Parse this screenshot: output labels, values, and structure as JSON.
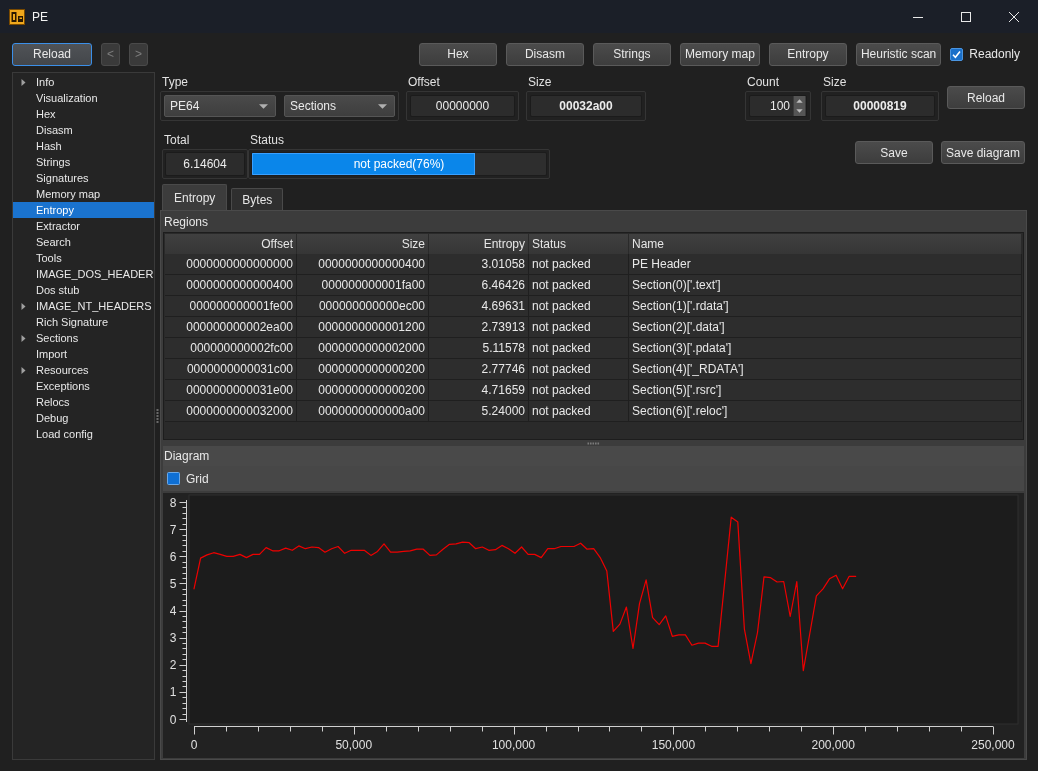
{
  "window": {
    "title": "PE"
  },
  "toolbar": {
    "reload": {
      "label": "Reload",
      "focused": true
    },
    "nav": [
      {
        "label": "<",
        "disabled": true
      },
      {
        "label": ">",
        "disabled": true
      }
    ],
    "views": [
      "Hex",
      "Disasm",
      "Strings",
      "Memory map",
      "Entropy",
      "Heuristic scan"
    ],
    "readonly": {
      "label": "Readonly",
      "checked": true
    }
  },
  "sidebar": {
    "items": [
      {
        "label": "Info",
        "kind": "group",
        "expanded": false,
        "selected": false
      },
      {
        "label": "Visualization",
        "kind": "item",
        "selected": false
      },
      {
        "label": "Hex",
        "kind": "item",
        "selected": false
      },
      {
        "label": "Disasm",
        "kind": "item",
        "selected": false
      },
      {
        "label": "Hash",
        "kind": "item",
        "selected": false
      },
      {
        "label": "Strings",
        "kind": "item",
        "selected": false
      },
      {
        "label": "Signatures",
        "kind": "item",
        "selected": false
      },
      {
        "label": "Memory map",
        "kind": "item",
        "selected": false
      },
      {
        "label": "Entropy",
        "kind": "item",
        "selected": true
      },
      {
        "label": "Extractor",
        "kind": "item",
        "selected": false
      },
      {
        "label": "Search",
        "kind": "item",
        "selected": false
      },
      {
        "label": "Tools",
        "kind": "item",
        "selected": false
      },
      {
        "label": "IMAGE_DOS_HEADER",
        "kind": "item",
        "selected": false
      },
      {
        "label": "Dos stub",
        "kind": "item",
        "selected": false
      },
      {
        "label": "IMAGE_NT_HEADERS",
        "kind": "group",
        "expanded": false,
        "selected": false
      },
      {
        "label": "Rich Signature",
        "kind": "item",
        "selected": false
      },
      {
        "label": "Sections",
        "kind": "group",
        "expanded": false,
        "selected": false
      },
      {
        "label": "Import",
        "kind": "item",
        "selected": false
      },
      {
        "label": "Resources",
        "kind": "group",
        "expanded": false,
        "selected": false
      },
      {
        "label": "Exceptions",
        "kind": "item",
        "selected": false
      },
      {
        "label": "Relocs",
        "kind": "item",
        "selected": false
      },
      {
        "label": "Debug",
        "kind": "item",
        "selected": false
      },
      {
        "label": "Load config",
        "kind": "item",
        "selected": false
      }
    ]
  },
  "entropy": {
    "type": {
      "label": "Type",
      "format": "PE64",
      "mode": "Sections"
    },
    "offset": {
      "label": "Offset",
      "value": "00000000"
    },
    "size": {
      "label": "Size",
      "value": "00032a00"
    },
    "count": {
      "label": "Count",
      "value": "100"
    },
    "block_size": {
      "label": "Size",
      "value": "00000819"
    },
    "reload": "Reload",
    "total": {
      "label": "Total",
      "value": "6.14604"
    },
    "status": {
      "label": "Status",
      "text": "not packed(76%)",
      "level": 0.76
    },
    "save": "Save",
    "save_diagram": "Save diagram"
  },
  "tabs": [
    {
      "label": "Entropy",
      "selected": true
    },
    {
      "label": "Bytes",
      "selected": false
    }
  ],
  "regions": {
    "title": "Regions",
    "columns": [
      "Offset",
      "Size",
      "Entropy",
      "Status",
      "Name"
    ],
    "rows": [
      [
        "0000000000000000",
        "0000000000000400",
        "3.01058",
        "not packed",
        "PE Header"
      ],
      [
        "0000000000000400",
        "000000000001fa00",
        "6.46426",
        "not packed",
        "Section(0)['.text']"
      ],
      [
        "000000000001fe00",
        "000000000000ec00",
        "4.69631",
        "not packed",
        "Section(1)['.rdata']"
      ],
      [
        "000000000002ea00",
        "0000000000001200",
        "2.73913",
        "not packed",
        "Section(2)['.data']"
      ],
      [
        "000000000002fc00",
        "0000000000002000",
        "5.11578",
        "not packed",
        "Section(3)['.pdata']"
      ],
      [
        "0000000000031c00",
        "0000000000000200",
        "2.77746",
        "not packed",
        "Section(4)['_RDATA']"
      ],
      [
        "0000000000031e00",
        "0000000000000200",
        "4.71659",
        "not packed",
        "Section(5)['.rsrc']"
      ],
      [
        "0000000000032000",
        "0000000000000a00",
        "5.24000",
        "not packed",
        "Section(6)['.reloc']"
      ]
    ]
  },
  "diagram": {
    "title": "Diagram",
    "grid": {
      "label": "Grid",
      "checked": false
    },
    "chart_data": {
      "type": "line",
      "x": [
        0,
        2050,
        4100,
        6150,
        8200,
        10250,
        12300,
        14350,
        16400,
        18450,
        20500,
        22550,
        24600,
        26650,
        28700,
        30750,
        32800,
        34850,
        36900,
        38950,
        41000,
        43050,
        45100,
        47150,
        49200,
        51250,
        53300,
        55350,
        57400,
        59450,
        61500,
        63550,
        65600,
        67650,
        69700,
        71750,
        73800,
        75850,
        77900,
        79950,
        82000,
        84050,
        86100,
        88150,
        90200,
        92250,
        94300,
        96350,
        98400,
        100450,
        102500,
        104550,
        106600,
        108650,
        110700,
        112750,
        114800,
        116850,
        118900,
        120950,
        123000,
        125050,
        127100,
        129150,
        131200,
        133250,
        135300,
        137350,
        139400,
        141450,
        143500,
        145550,
        147600,
        149650,
        151700,
        153750,
        155800,
        157850,
        159900,
        161950,
        164000,
        166050,
        168100,
        170150,
        172200,
        174250,
        176300,
        178350,
        180400,
        182450,
        184500,
        186550,
        188600,
        190650,
        192700,
        194750,
        196800,
        198850,
        200900,
        202950,
        205000,
        207050
      ],
      "series": [
        {
          "color": "#ee0000",
          "values": [
            4.8,
            5.93,
            6.05,
            6.13,
            6.07,
            6.0,
            6.0,
            6.07,
            5.95,
            6.07,
            6.07,
            6.32,
            6.2,
            6.2,
            6.3,
            6.22,
            6.38,
            6.28,
            6.34,
            6.32,
            6.15,
            6.28,
            6.36,
            6.11,
            6.22,
            6.22,
            6.22,
            6.03,
            6.18,
            6.46,
            6.15,
            6.15,
            6.18,
            6.2,
            6.26,
            6.26,
            6.03,
            6.05,
            6.26,
            6.44,
            6.46,
            6.52,
            6.5,
            6.28,
            6.34,
            6.22,
            6.24,
            6.4,
            6.28,
            6.11,
            6.34,
            6.07,
            6.07,
            5.95,
            6.28,
            6.28,
            6.36,
            6.36,
            6.36,
            6.48,
            6.26,
            6.28,
            5.95,
            5.46,
            3.23,
            3.5,
            4.13,
            2.6,
            4.25,
            5.13,
            3.74,
            3.48,
            3.8,
            3.05,
            3.1,
            3.1,
            2.72,
            2.8,
            2.8,
            2.68,
            2.68,
            5.06,
            7.44,
            7.26,
            3.31,
            2.04,
            3.19,
            5.24,
            5.21,
            5.05,
            5.07,
            3.78,
            5.07,
            1.78,
            3.17,
            4.54,
            4.8,
            5.17,
            5.3,
            4.8,
            5.26,
            5.26
          ]
        }
      ],
      "xlim": [
        0,
        250000
      ],
      "ylim": [
        0,
        8
      ],
      "xticks": [
        {
          "value": 0,
          "label": "0"
        },
        {
          "value": 50000,
          "label": "50,000"
        },
        {
          "value": 100000,
          "label": "100,000"
        },
        {
          "value": 150000,
          "label": "150,000"
        },
        {
          "value": 200000,
          "label": "200,000"
        },
        {
          "value": 250000,
          "label": "250,000"
        }
      ],
      "yticks": [
        0,
        1,
        2,
        3,
        4,
        5,
        6,
        7,
        8
      ]
    }
  }
}
